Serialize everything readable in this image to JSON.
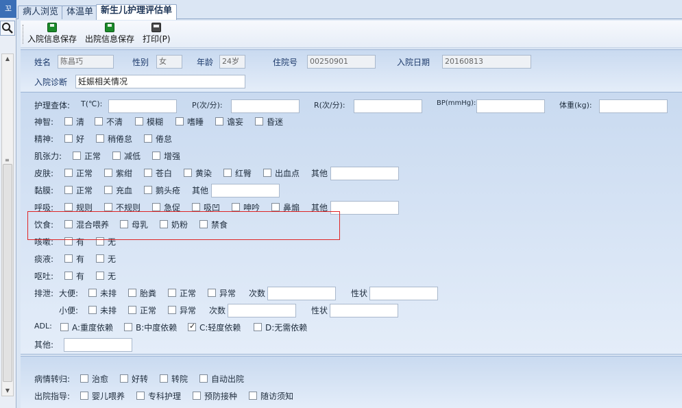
{
  "left_rail": {
    "pin_glyph": "꼬"
  },
  "tabs": [
    {
      "label": "病人浏览"
    },
    {
      "label": "体温单"
    },
    {
      "label": "新生儿护理评估单"
    }
  ],
  "toolbar": {
    "admit_save": "入院信息保存",
    "discharge_save": "出院信息保存",
    "print": "打印(P)"
  },
  "patient": {
    "name_label": "姓名",
    "name": "陈昌巧",
    "sex_label": "性别",
    "sex": "女",
    "age_label": "年龄",
    "age": "24岁",
    "admission_no_label": "住院号",
    "admission_no": "00250901",
    "admit_date_label": "入院日期",
    "admit_date": "20160813",
    "diagnosis_label": "入院诊断",
    "diagnosis": "妊娠相关情况"
  },
  "exam": {
    "label": "护理查体:",
    "t_label": "T(℃):",
    "p_label": "P(次/分):",
    "r_label": "R(次/分):",
    "bp_label": "BP(mmHg):",
    "weight_label": "体重(kg):"
  },
  "rows": {
    "consciousness": {
      "label": "神智:",
      "options": [
        "清",
        "不清",
        "模糊",
        "嗜睡",
        "谵妄",
        "昏迷"
      ]
    },
    "spirit": {
      "label": "精神:",
      "options": [
        "好",
        "稍倦怠",
        "倦怠"
      ]
    },
    "muscle": {
      "label": "肌张力:",
      "options": [
        "正常",
        "减低",
        "增强"
      ]
    },
    "skin": {
      "label": "皮肤:",
      "options": [
        "正常",
        "紫绀",
        "苍白",
        "黄染",
        "红臀",
        "出血点"
      ],
      "other": "其他"
    },
    "mucosa": {
      "label": "黏膜:",
      "options": [
        "正常",
        "充血",
        "鹅头疮"
      ],
      "other": "其他"
    },
    "breathing": {
      "label": "呼吸:",
      "options": [
        "规则",
        "不规则",
        "急促",
        "吸凹",
        "呻吟",
        "鼻煽"
      ],
      "other": "其他"
    },
    "diet": {
      "label": "饮食:",
      "options": [
        "混合喂养",
        "母乳",
        "奶粉",
        "禁食"
      ]
    },
    "cough": {
      "label": "咳嗽:",
      "options": [
        "有",
        "无"
      ]
    },
    "sputum": {
      "label": "痰液:",
      "options": [
        "有",
        "无"
      ]
    },
    "vomit": {
      "label": "呕吐:",
      "options": [
        "有",
        "无"
      ]
    },
    "excretion": {
      "label": "排泄:",
      "stool_label": "大便:",
      "stool_options": [
        "未排",
        "胎粪",
        "正常",
        "异常"
      ],
      "count_label": "次数",
      "shape_label": "性状",
      "urine_label": "小便:",
      "urine_options": [
        "未排",
        "正常",
        "异常"
      ]
    },
    "adl": {
      "label": "ADL:",
      "options": [
        "A:重度依赖",
        "B:中度依赖",
        "C:轻度依赖",
        "D:无需依赖"
      ],
      "checked_index": 2
    },
    "other": {
      "label": "其他:"
    }
  },
  "discharge": {
    "outcome_label": "病情转归:",
    "outcome_options": [
      "治愈",
      "好转",
      "转院",
      "自动出院"
    ],
    "guidance_label": "出院指导:",
    "guidance_options": [
      "婴儿喂养",
      "专科护理",
      "预防接种",
      "随访须知"
    ]
  },
  "colors": {
    "accent": "#3b6fb6",
    "panel": "#d6e3f4",
    "highlight": "#e02424"
  }
}
